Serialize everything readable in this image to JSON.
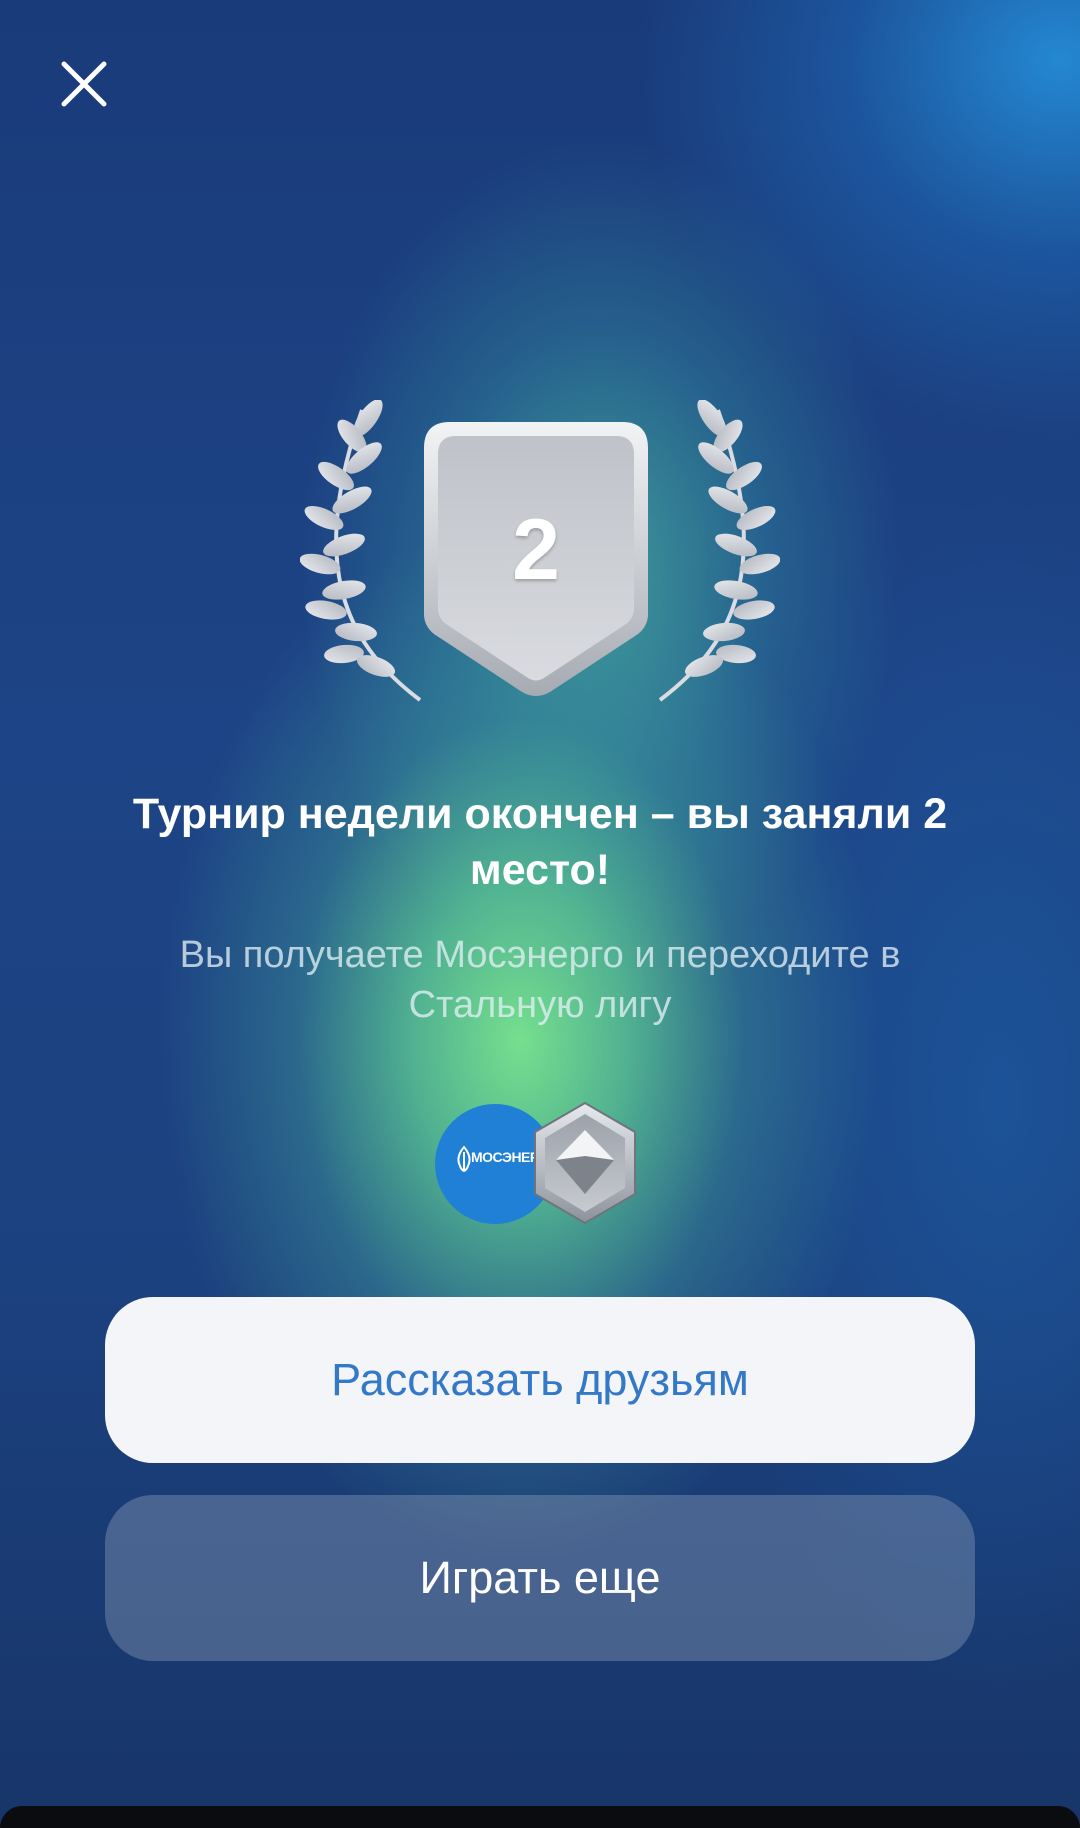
{
  "header": {
    "close_icon": "close-icon"
  },
  "trophy": {
    "place": "2",
    "icons": [
      "laurel-left-icon",
      "shield-icon",
      "laurel-right-icon"
    ],
    "colors": {
      "silver_light": "#e4e6ea",
      "silver_dark": "#9a9ea6"
    }
  },
  "result": {
    "title": "Турнир недели окончен – вы заняли 2 место!",
    "subtitle": "Вы получаете Мосэнерго и переходите в Стальную лигу"
  },
  "rewards": {
    "logo_text": "МОСЭНЕРГО",
    "logo_icon": "mosenergo-logo-icon",
    "league_icon": "steel-league-badge-icon",
    "colors": {
      "logo_bg": "#1f80d6"
    }
  },
  "actions": {
    "share_label": "Рассказать друзьям",
    "play_label": "Играть еще"
  },
  "colors": {
    "accent_text": "#3478c8",
    "bg_blue": "#1a3b7a",
    "bg_green": "#7ae88e"
  }
}
